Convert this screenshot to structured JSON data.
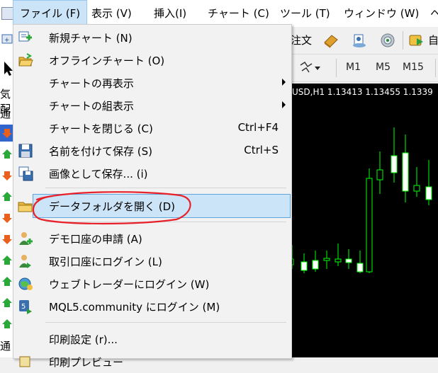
{
  "menubar": {
    "items": [
      {
        "label": "ファイル (F)",
        "active": true
      },
      {
        "label": "表示 (V)"
      },
      {
        "label": "挿入(I)"
      },
      {
        "label": "チャート (C)"
      },
      {
        "label": "ツール (T)"
      },
      {
        "label": "ウィンドウ (W)"
      },
      {
        "label": "ヘ"
      }
    ]
  },
  "toolbar1": {
    "order_text": "注文",
    "auto_text": "自"
  },
  "toolbar2": {
    "timeframes": [
      "M1",
      "M5",
      "M15"
    ]
  },
  "left_panel": {
    "text_top": "気配",
    "text_mid": "通",
    "text_bottom": "通"
  },
  "chart": {
    "title": "USD,H1  1.13413 1.13455 1.1339"
  },
  "file_menu": {
    "items": [
      {
        "label": "新規チャート (N)",
        "icon": "new-chart-icon"
      },
      {
        "label": "オフラインチャート (O)",
        "icon": "folder-open-icon"
      },
      {
        "label": "チャートの再表示",
        "submenu": true
      },
      {
        "label": "チャートの組表示",
        "submenu": true
      },
      {
        "label": "チャートを閉じる (C)",
        "shortcut": "Ctrl+F4"
      },
      {
        "label": "名前を付けて保存 (S)",
        "shortcut": "Ctrl+S",
        "icon": "save-icon"
      },
      {
        "label": "画像として保存... (i)",
        "icon": "save-image-icon"
      },
      {
        "label": "データフォルダを開く (D)",
        "icon": "folder-icon",
        "highlighted": true
      },
      {
        "label": "デモ口座の申請 (A)",
        "icon": "demo-account-icon"
      },
      {
        "label": "取引口座にログイン (L)",
        "icon": "trade-login-icon"
      },
      {
        "label": "ウェブトレーダーにログイン (W)",
        "icon": "web-trader-icon"
      },
      {
        "label": "MQL5.community にログイン (M)",
        "icon": "mql5-icon"
      },
      {
        "label": "印刷設定 (r)..."
      },
      {
        "label": "印刷プレビュー"
      }
    ]
  },
  "colors": {
    "highlight": "#cce4f7",
    "annotation": "#e8202a",
    "candle": "#00ff00"
  }
}
